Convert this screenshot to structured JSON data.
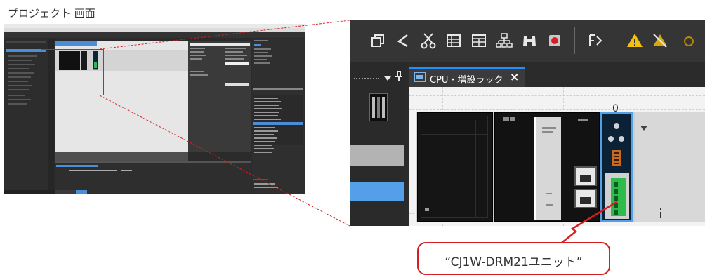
{
  "caption": "プロジェクト 画面",
  "zoom": {
    "tab_label": "CPU・増設ラック",
    "tab_close": "×",
    "slot_number": "0",
    "toolbar_icons": [
      "window-layout-icon",
      "pointer-tool-icon",
      "cut-icon",
      "ladder-grid-icon",
      "table-view-icon",
      "network-icon",
      "binoculars-search-icon",
      "record-icon",
      "compile-icon",
      "warning-icon",
      "disable-warning-icon"
    ],
    "panel_pin_icon": "pin-icon"
  },
  "callout": {
    "text": "“CJ1W-DRM21ユニット”"
  },
  "colors": {
    "accent": "#1e90ff",
    "callout_border": "#d51f24",
    "highlight_box": "#d51f24",
    "unit_green": "#2dbb4a"
  }
}
